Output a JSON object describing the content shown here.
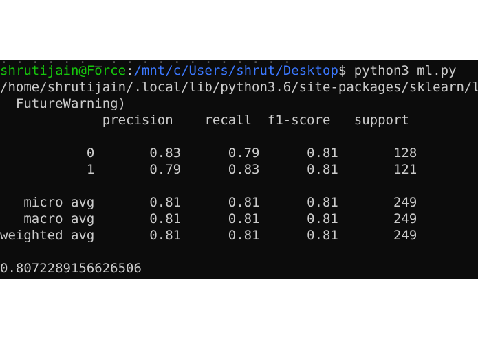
{
  "terminal": {
    "prompt": {
      "user_host": "shrutijain@Force",
      "separator": ":",
      "path": "/mnt/c/Users/shrut/Desktop",
      "symbol": "$",
      "command": " python3 ml.py"
    },
    "warning_path": "/home/shrutijain/.local/lib/python3.6/site-packages/sklearn/l",
    "warning_tail": "  FutureWarning)",
    "report": {
      "header": "             precision    recall  f1-score   support",
      "rows": [
        "           0       0.83      0.79      0.81       128",
        "           1       0.79      0.83      0.81       121",
        "   micro avg       0.81      0.81      0.81       249",
        "   macro avg       0.81      0.81      0.81       249",
        "weighted avg       0.81      0.81      0.81       249"
      ]
    },
    "accuracy": "0.8072289156626506"
  },
  "colors": {
    "background": "#0c0c0c",
    "text": "#cccccc",
    "user_host": "#16c60c",
    "path": "#3b78ff"
  }
}
